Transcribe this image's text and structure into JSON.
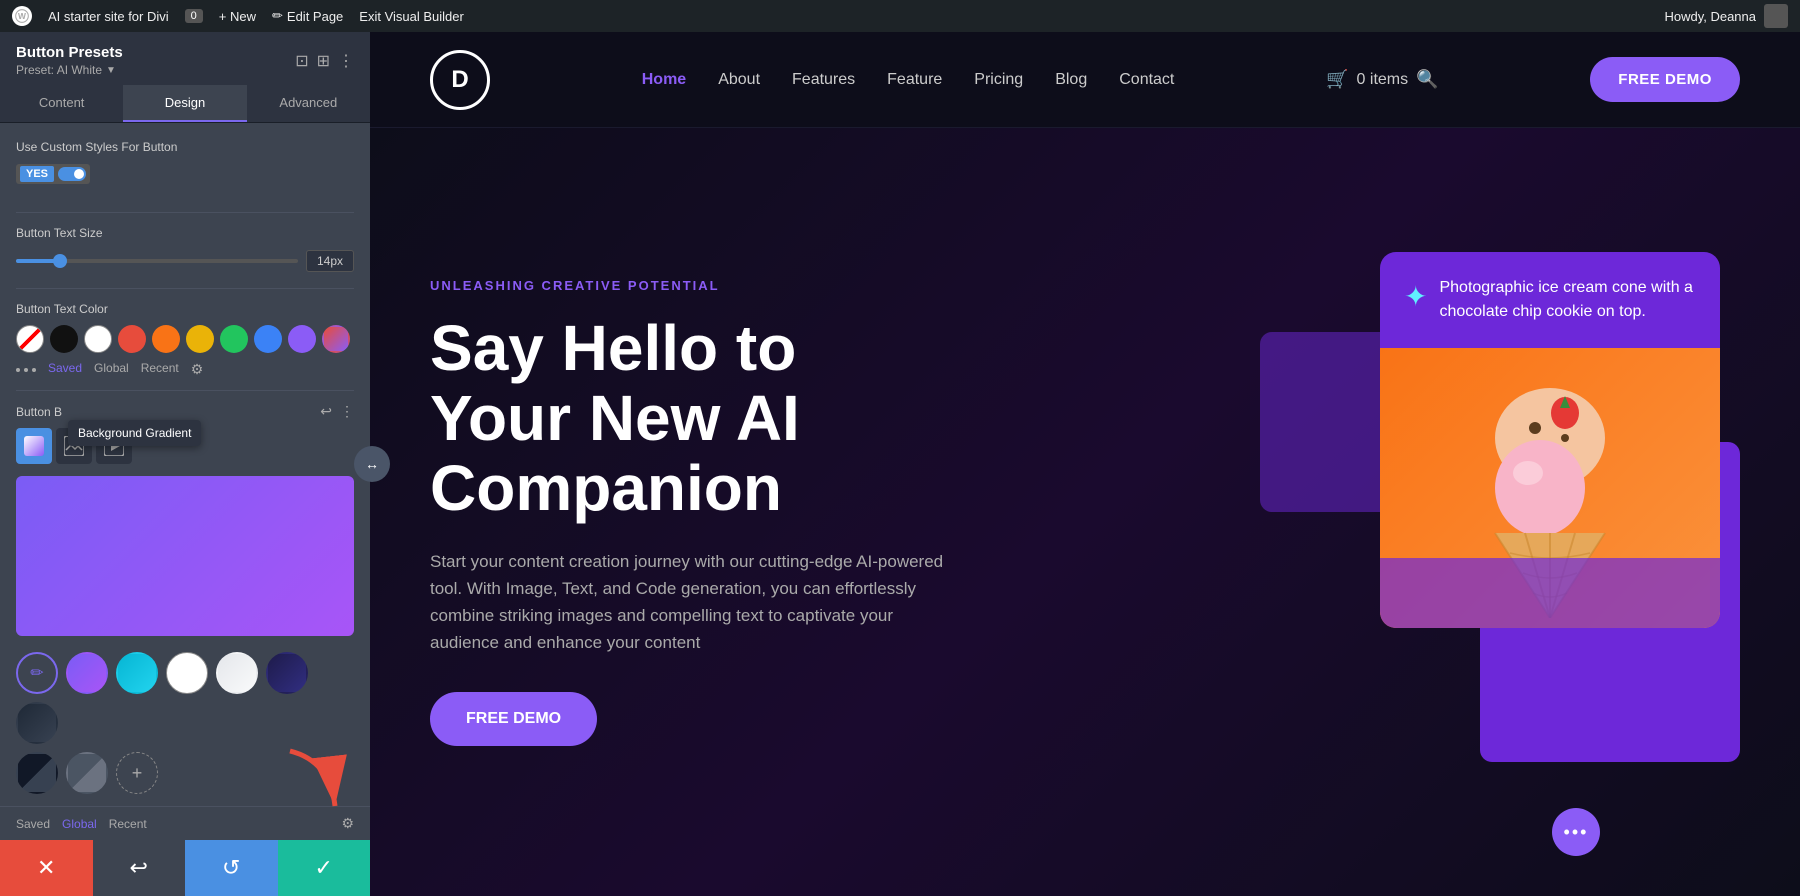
{
  "wp_admin_bar": {
    "wp_icon": "W",
    "site_name": "AI starter site for Divi",
    "comments_count": "0",
    "new_label": "New",
    "edit_page_label": "Edit Page",
    "exit_vb_label": "Exit Visual Builder",
    "user_label": "Howdy, Deanna"
  },
  "left_panel": {
    "title": "Button Presets",
    "preset_label": "Preset: AI White",
    "tabs": [
      "Content",
      "Design",
      "Advanced"
    ],
    "active_tab": "Design",
    "custom_styles_label": "Use Custom Styles For Button",
    "toggle_yes": "YES",
    "button_text_size_label": "Button Text Size",
    "slider_value": "14px",
    "button_text_color_label": "Button Text Color",
    "color_tabs": [
      "Saved",
      "Global",
      "Recent"
    ],
    "active_color_tab": "Saved",
    "button_bg_label": "Button B",
    "tooltip_text": "Background Gradient",
    "bg_tabs": [
      "gradient",
      "image",
      "video"
    ],
    "gradient_preview_colors": [
      "#7b5cf5",
      "#a855f7"
    ],
    "preset_swatches_row1": [
      {
        "id": "purple",
        "label": "Purple gradient"
      },
      {
        "id": "teal",
        "label": "Teal gradient"
      },
      {
        "id": "white",
        "label": "White"
      },
      {
        "id": "lightgray",
        "label": "Light gray"
      },
      {
        "id": "darkpurple",
        "label": "Dark purple"
      },
      {
        "id": "dark",
        "label": "Dark"
      }
    ],
    "preset_swatches_row2": [
      {
        "id": "black1",
        "label": "Black 1"
      },
      {
        "id": "black2",
        "label": "Black 2"
      },
      {
        "id": "plus",
        "label": "Add"
      }
    ],
    "bottom_tabs": [
      "Saved",
      "Global",
      "Recent"
    ],
    "active_bottom_tab": "Global"
  },
  "bottom_actions": {
    "cancel_icon": "✕",
    "undo_icon": "↩",
    "redo_icon": "↺",
    "confirm_icon": "✓"
  },
  "site_nav": {
    "logo": "D",
    "links": [
      {
        "label": "Home",
        "active": true
      },
      {
        "label": "About",
        "active": false
      },
      {
        "label": "Features",
        "active": false
      },
      {
        "label": "Feature",
        "active": false
      },
      {
        "label": "Pricing",
        "active": false
      },
      {
        "label": "Blog",
        "active": false
      },
      {
        "label": "Contact",
        "active": false
      }
    ],
    "cart_label": "0 items",
    "free_demo_label": "FREE DEMO"
  },
  "hero": {
    "eyebrow": "UNLEASHING CREATIVE POTENTIAL",
    "title_line1": "Say Hello to",
    "title_line2": "Your New AI",
    "title_line3": "Companion",
    "subtitle": "Start your content creation journey with our cutting-edge AI-powered tool. With Image, Text, and Code generation, you can effortlessly combine striking images and compelling text to captivate your audience and enhance your content",
    "cta_label": "FREE DEMO",
    "ai_card_text": "Photographic ice cream cone with a chocolate chip cookie on top."
  },
  "colors": {
    "accent_purple": "#8b5cf6",
    "dark_bg": "#0d0d1a",
    "panel_bg": "#3d4450",
    "panel_dark": "#2d3340"
  }
}
